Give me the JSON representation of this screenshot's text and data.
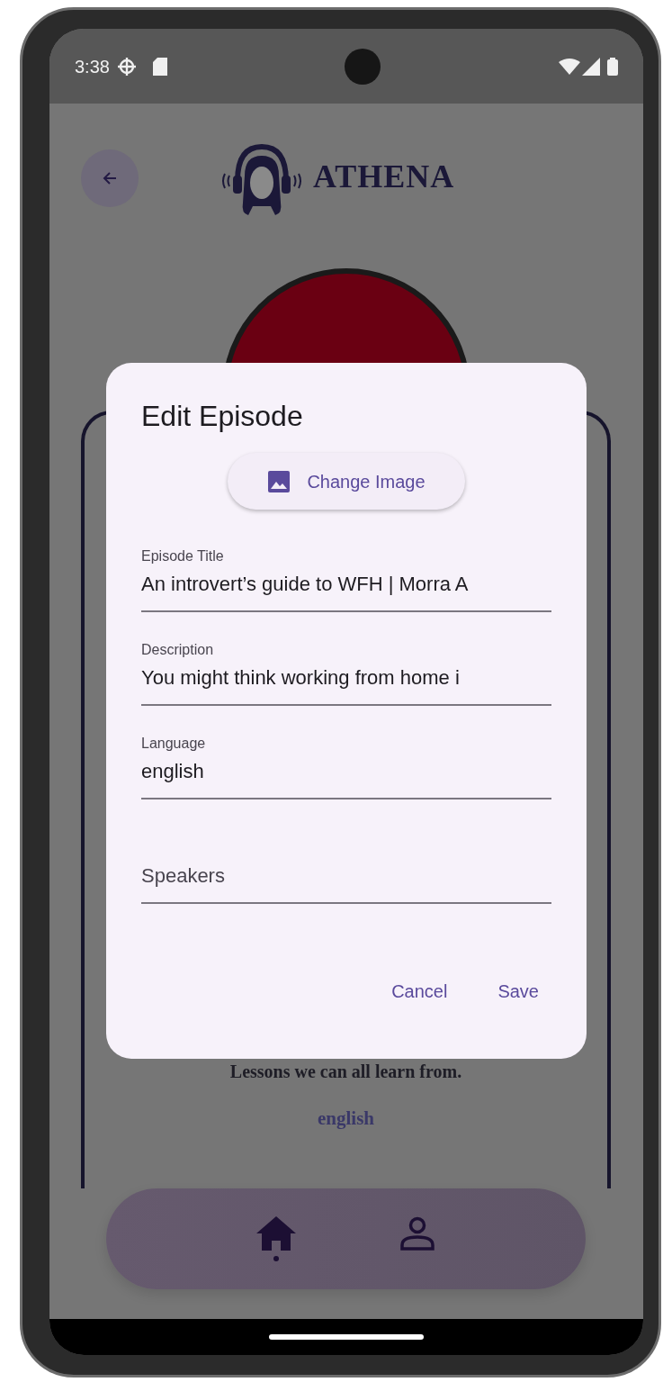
{
  "status_bar": {
    "time": "3:38"
  },
  "header": {
    "title": "ATHENA"
  },
  "episode_card": {
    "description": "Lessons we can all learn from.",
    "language": "english"
  },
  "bottom_nav": [
    {
      "kind": "home",
      "selected": true
    },
    {
      "kind": "person",
      "selected": false
    }
  ],
  "dialog": {
    "title": "Edit Episode",
    "image_button": "Change Image",
    "fields": [
      {
        "label": "Episode Title",
        "value": "An introvert’s guide to WFH | Morra A"
      },
      {
        "label": "Description",
        "value": "You might think working from home i"
      },
      {
        "label": "Language",
        "value": "english"
      },
      {
        "placeholder": "Speakers"
      }
    ],
    "actions": [
      "Cancel",
      "Save"
    ]
  }
}
